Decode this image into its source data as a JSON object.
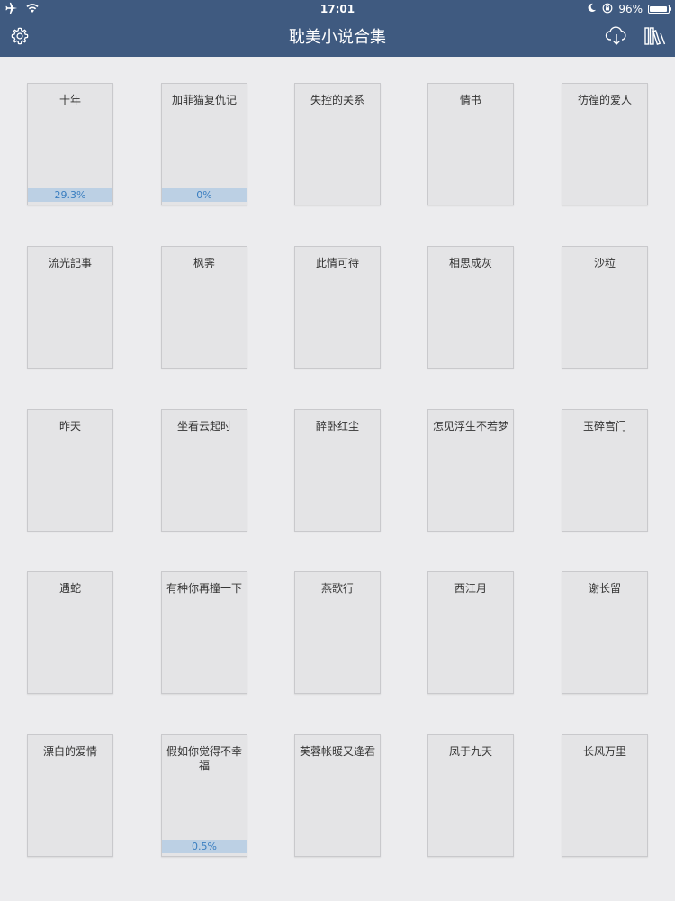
{
  "status_bar": {
    "time": "17:01",
    "battery_percent": "96%",
    "battery_level": 0.96,
    "icons": [
      "airplane-icon",
      "wifi-icon",
      "moon-icon",
      "rotation-lock-icon",
      "battery-icon"
    ]
  },
  "nav_bar": {
    "title": "耽美小说合集",
    "left_icon": "gear-icon",
    "right_icons": [
      "cloud-download-icon",
      "bookshelf-icon"
    ],
    "background_color": "#3f5a80"
  },
  "books": [
    {
      "title": "十年",
      "progress": "29.3%"
    },
    {
      "title": "加菲猫复仇记",
      "progress": "0%"
    },
    {
      "title": "失控的关系"
    },
    {
      "title": "情书"
    },
    {
      "title": "彷徨的爱人"
    },
    {
      "title": "流光記事"
    },
    {
      "title": "枫霁"
    },
    {
      "title": "此情可待"
    },
    {
      "title": "相思成灰"
    },
    {
      "title": "沙粒"
    },
    {
      "title": "昨天"
    },
    {
      "title": "坐看云起时"
    },
    {
      "title": "醉卧红尘"
    },
    {
      "title": "怎见浮生不若梦"
    },
    {
      "title": "玉碎宫门"
    },
    {
      "title": "遇蛇"
    },
    {
      "title": "有种你再撞一下"
    },
    {
      "title": "燕歌行"
    },
    {
      "title": "西江月"
    },
    {
      "title": "谢长留"
    },
    {
      "title": "漂白的爱情"
    },
    {
      "title": "假如你觉得不幸福",
      "progress": "0.5%"
    },
    {
      "title": "芙蓉帐暖又逢君"
    },
    {
      "title": "凤于九天"
    },
    {
      "title": "长风万里"
    }
  ]
}
